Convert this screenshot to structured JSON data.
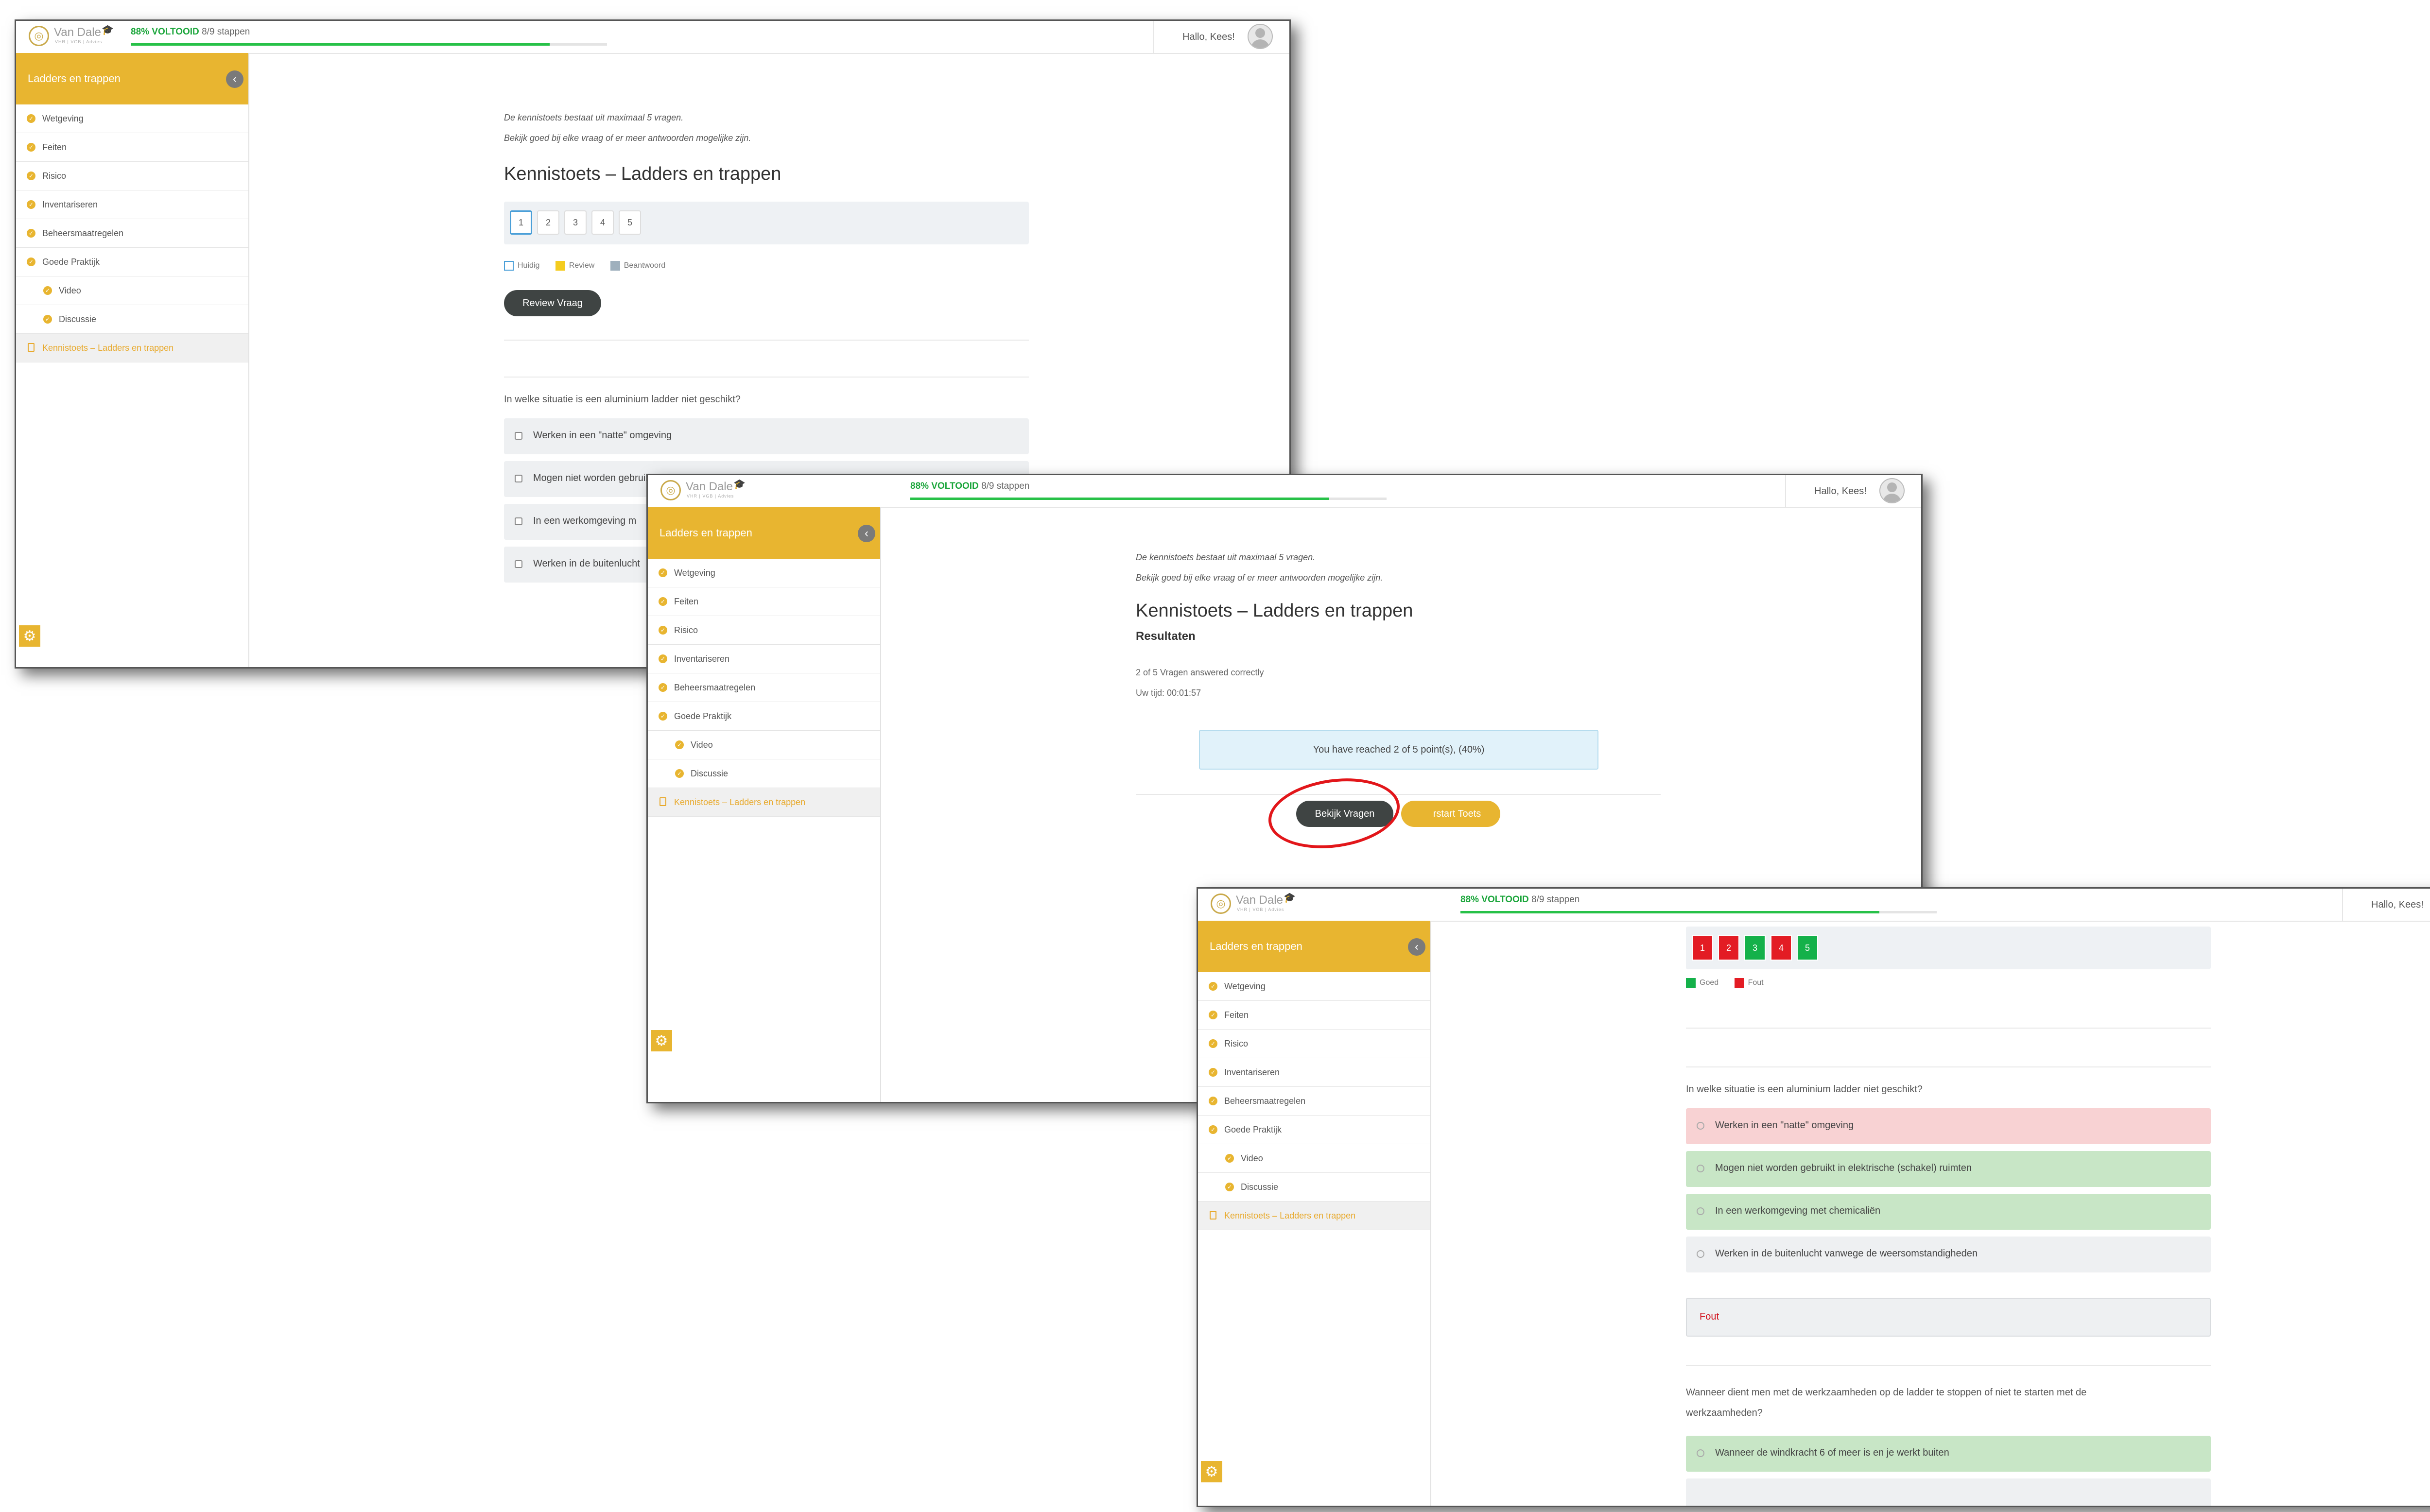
{
  "common": {
    "logo_name": "Van Dale",
    "logo_tagline": "VHR | VGB | Advies",
    "progress_pct": "88% VOLTOOID",
    "progress_steps": "8/9 stappen",
    "progress_fraction": 0.88,
    "greeting": "Hallo, Kees!",
    "sidebar_title": "Ladders en trappen",
    "sidebar_items": [
      "Wetgeving",
      "Feiten",
      "Risico",
      "Inventariseren",
      "Beheersmaatregelen",
      "Goede Praktijk"
    ],
    "sidebar_subitems": [
      "Video",
      "Discussie"
    ],
    "sidebar_active": "Kennistoets – Ladders en trappen",
    "intro_line1": "De kennistoets bestaat uit maximaal 5 vragen.",
    "intro_line2": "Bekijk goed bij elke vraag of er meer antwoorden mogelijke zijn.",
    "quiz_title": "Kennistoets – Ladders en trappen"
  },
  "win1": {
    "question_numbers": [
      "1",
      "2",
      "3",
      "4",
      "5"
    ],
    "legend": [
      "Huidig",
      "Review",
      "Beantwoord"
    ],
    "review_button": "Review Vraag",
    "question": "In welke situatie is een aluminium ladder niet geschikt?",
    "answers": [
      "Werken in een \"natte\" omgeving",
      "Mogen niet worden gebruikt in elektrische (schakel) ruimten",
      "In een werkomgeving met chemicaliën",
      "Werken in de buitenlucht vanwege de weersomstandigheden"
    ],
    "answers_partial": [
      "In een werkomgeving m",
      "Werken in de buitenlucht"
    ]
  },
  "win2": {
    "results_heading": "Resultaten",
    "correct_text": "2 of 5 Vragen answered correctly",
    "time_text": "Uw tijd: 00:01:57",
    "score_text": "You have reached 2 of 5 point(s), (40%)",
    "view_button": "Bekijk Vragen",
    "restart_button": "Herstart Toets",
    "restart_visible": "rstart Toets"
  },
  "win3": {
    "result_numbers": [
      {
        "n": "1",
        "status": "fout"
      },
      {
        "n": "2",
        "status": "fout"
      },
      {
        "n": "3",
        "status": "goed"
      },
      {
        "n": "4",
        "status": "fout"
      },
      {
        "n": "5",
        "status": "goed"
      }
    ],
    "legend": [
      "Goed",
      "Fout"
    ],
    "question1": "In welke situatie is een aluminium ladder niet geschikt?",
    "answers1": [
      {
        "text": "Werken in een \"natte\" omgeving",
        "state": "wrong"
      },
      {
        "text": "Mogen niet worden gebruikt in elektrische (schakel) ruimten",
        "state": "correct"
      },
      {
        "text": "In een werkomgeving met chemicaliën",
        "state": "correct"
      },
      {
        "text": "Werken in de buitenlucht vanwege de weersomstandigheden",
        "state": "neutral"
      }
    ],
    "verdict": "Fout",
    "question2_line1": "Wanneer dient men met de werkzaamheden op de ladder te stoppen of niet te starten met de",
    "question2_line2": "werkzaamheden?",
    "answer2_first": "Wanneer de windkracht 6 of meer is en je werkt buiten"
  },
  "colors": {
    "accent": "#e8b530",
    "correct": "#14b14a",
    "wrong": "#e31c24",
    "progress": "#27c148"
  }
}
